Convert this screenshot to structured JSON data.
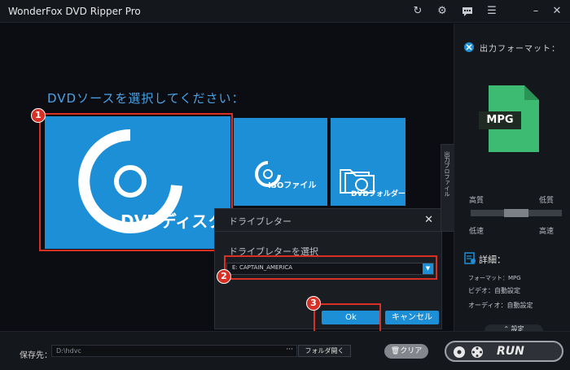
{
  "app": {
    "title": "WonderFox DVD Ripper Pro"
  },
  "titlebar_icons": [
    "refresh-icon",
    "settings-gear-icon",
    "chat-icon",
    "menu-list-icon",
    "minimize-icon",
    "close-icon"
  ],
  "main": {
    "prompt": "DVDソースを選択してください：",
    "tiles": {
      "dvd_label": "DVDディスク",
      "iso_label": "ISOファイル",
      "folder_label": "DVDフォルダー"
    }
  },
  "steps": [
    "1",
    "2",
    "3"
  ],
  "dialog": {
    "title": "ドライブレター",
    "subtitle": "ドライブレターを選択",
    "selected_drive": "E:  CAPTAIN_AMERICA",
    "ok_label": "Ok",
    "cancel_label": "キャンセル"
  },
  "right_panel": {
    "output_format_label": "出力フォーマット：",
    "format_badge": "MPG",
    "profile_tab": "出力プロファイル",
    "quality_high": "高質",
    "quality_low": "低質",
    "speed_low": "低速",
    "speed_high": "高速",
    "quality_level": 0.5,
    "details_label": "詳細：",
    "format_line": "フォーマット：MPG",
    "video_line": "ビデオ：自動設定",
    "audio_line": "オーディオ：自動設定",
    "settings_label": "設定"
  },
  "bottom": {
    "save_label": "保存先：",
    "save_path": "D:\\hdvc",
    "browse_label": "···",
    "open_folder_label": "フォルダ開く",
    "clear_label": "クリア",
    "run_label": "RUN"
  },
  "colors": {
    "accent": "#1d8fd6",
    "highlight": "#d93025",
    "file_green": "#3dbb73"
  }
}
